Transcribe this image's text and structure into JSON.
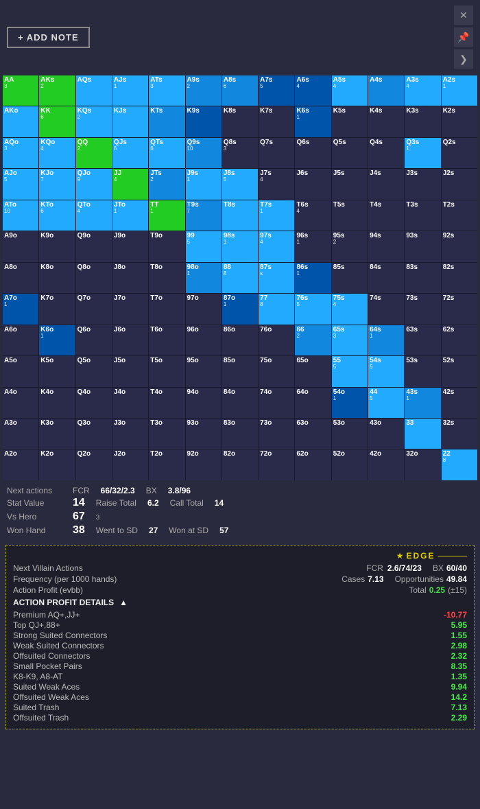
{
  "header": {
    "add_note_label": "+ ADD NOTE",
    "close_icon": "✕",
    "pin_icon": "📌",
    "arrow_icon": "❯"
  },
  "matrix": {
    "cells": [
      {
        "label": "AA",
        "count": "3",
        "color": "c-green"
      },
      {
        "label": "AKs",
        "count": "2",
        "color": "c-green"
      },
      {
        "label": "AQs",
        "count": "",
        "color": "c-blue-bright"
      },
      {
        "label": "AJs",
        "count": "1",
        "color": "c-blue-bright"
      },
      {
        "label": "ATs",
        "count": "3",
        "color": "c-blue-bright"
      },
      {
        "label": "A9s",
        "count": "2",
        "color": "c-blue-med"
      },
      {
        "label": "A8s",
        "count": "6",
        "color": "c-blue-med"
      },
      {
        "label": "A7s",
        "count": "5",
        "color": "c-blue-dark"
      },
      {
        "label": "A6s",
        "count": "4",
        "color": "c-blue-dark"
      },
      {
        "label": "A5s",
        "count": "4",
        "color": "c-blue-bright"
      },
      {
        "label": "A4s",
        "count": "",
        "color": "c-blue-med"
      },
      {
        "label": "A3s",
        "count": "4",
        "color": "c-blue-bright"
      },
      {
        "label": "A2s",
        "count": "1",
        "color": "c-blue-bright"
      },
      {
        "label": "AKo",
        "count": "",
        "color": "c-blue-bright"
      },
      {
        "label": "KK",
        "count": "6",
        "color": "c-green"
      },
      {
        "label": "KQs",
        "count": "2",
        "color": "c-blue-bright"
      },
      {
        "label": "KJs",
        "count": "",
        "color": "c-blue-bright"
      },
      {
        "label": "KTs",
        "count": "",
        "color": "c-blue-med"
      },
      {
        "label": "K9s",
        "count": "",
        "color": "c-blue-dark"
      },
      {
        "label": "K8s",
        "count": "",
        "color": "c-dark-cell"
      },
      {
        "label": "K7s",
        "count": "",
        "color": "c-dark-cell"
      },
      {
        "label": "K6s",
        "count": "1",
        "color": "c-blue-dark"
      },
      {
        "label": "K5s",
        "count": "",
        "color": "c-dark-cell"
      },
      {
        "label": "K4s",
        "count": "",
        "color": "c-dark-cell"
      },
      {
        "label": "K3s",
        "count": "",
        "color": "c-dark-cell"
      },
      {
        "label": "K2s",
        "count": "",
        "color": "c-dark-cell"
      },
      {
        "label": "AQo",
        "count": "3",
        "color": "c-blue-bright"
      },
      {
        "label": "KQo",
        "count": "4",
        "color": "c-blue-bright"
      },
      {
        "label": "QQ",
        "count": "2",
        "color": "c-green"
      },
      {
        "label": "QJs",
        "count": "6",
        "color": "c-blue-bright"
      },
      {
        "label": "QTs",
        "count": "6",
        "color": "c-blue-bright"
      },
      {
        "label": "Q9s",
        "count": "10",
        "color": "c-blue-med"
      },
      {
        "label": "Q8s",
        "count": "3",
        "color": "c-dark-cell"
      },
      {
        "label": "Q7s",
        "count": "",
        "color": "c-dark-cell"
      },
      {
        "label": "Q6s",
        "count": "",
        "color": "c-dark-cell"
      },
      {
        "label": "Q5s",
        "count": "",
        "color": "c-dark-cell"
      },
      {
        "label": "Q4s",
        "count": "",
        "color": "c-dark-cell"
      },
      {
        "label": "Q3s",
        "count": "1",
        "color": "c-blue-bright"
      },
      {
        "label": "Q2s",
        "count": "",
        "color": "c-dark-cell"
      },
      {
        "label": "AJo",
        "count": "5",
        "color": "c-blue-bright"
      },
      {
        "label": "KJo",
        "count": "7",
        "color": "c-blue-bright"
      },
      {
        "label": "QJo",
        "count": "9",
        "color": "c-blue-bright"
      },
      {
        "label": "JJ",
        "count": "4",
        "color": "c-green"
      },
      {
        "label": "JTs",
        "count": "2",
        "color": "c-blue-med"
      },
      {
        "label": "J9s",
        "count": "1",
        "color": "c-blue-bright"
      },
      {
        "label": "J8s",
        "count": "5",
        "color": "c-blue-bright"
      },
      {
        "label": "J7s",
        "count": "4",
        "color": "c-dark-cell"
      },
      {
        "label": "J6s",
        "count": "",
        "color": "c-dark-cell"
      },
      {
        "label": "J5s",
        "count": "",
        "color": "c-dark-cell"
      },
      {
        "label": "J4s",
        "count": "",
        "color": "c-dark-cell"
      },
      {
        "label": "J3s",
        "count": "",
        "color": "c-dark-cell"
      },
      {
        "label": "J2s",
        "count": "",
        "color": "c-dark-cell"
      },
      {
        "label": "ATo",
        "count": "10",
        "color": "c-blue-bright"
      },
      {
        "label": "KTo",
        "count": "6",
        "color": "c-blue-bright"
      },
      {
        "label": "QTo",
        "count": "4",
        "color": "c-blue-bright"
      },
      {
        "label": "JTo",
        "count": "1",
        "color": "c-blue-bright"
      },
      {
        "label": "TT",
        "count": "1",
        "color": "c-green"
      },
      {
        "label": "T9s",
        "count": "7",
        "color": "c-blue-med"
      },
      {
        "label": "T8s",
        "count": "",
        "color": "c-blue-bright"
      },
      {
        "label": "T7s",
        "count": "1",
        "color": "c-blue-bright"
      },
      {
        "label": "T6s",
        "count": "4",
        "color": "c-dark-cell"
      },
      {
        "label": "T5s",
        "count": "",
        "color": "c-dark-cell"
      },
      {
        "label": "T4s",
        "count": "",
        "color": "c-dark-cell"
      },
      {
        "label": "T3s",
        "count": "",
        "color": "c-dark-cell"
      },
      {
        "label": "T2s",
        "count": "",
        "color": "c-dark-cell"
      },
      {
        "label": "A9o",
        "count": "",
        "color": "c-dark-cell"
      },
      {
        "label": "K9o",
        "count": "",
        "color": "c-dark-cell"
      },
      {
        "label": "Q9o",
        "count": "",
        "color": "c-dark-cell"
      },
      {
        "label": "J9o",
        "count": "",
        "color": "c-dark-cell"
      },
      {
        "label": "T9o",
        "count": "",
        "color": "c-dark-cell"
      },
      {
        "label": "99",
        "count": "5",
        "color": "c-blue-bright"
      },
      {
        "label": "98s",
        "count": "1",
        "color": "c-blue-bright"
      },
      {
        "label": "97s",
        "count": "4",
        "color": "c-blue-bright"
      },
      {
        "label": "96s",
        "count": "1",
        "color": "c-dark-cell"
      },
      {
        "label": "95s",
        "count": "2",
        "color": "c-dark-cell"
      },
      {
        "label": "94s",
        "count": "",
        "color": "c-dark-cell"
      },
      {
        "label": "93s",
        "count": "",
        "color": "c-dark-cell"
      },
      {
        "label": "92s",
        "count": "",
        "color": "c-dark-cell"
      },
      {
        "label": "A8o",
        "count": "",
        "color": "c-dark-cell"
      },
      {
        "label": "K8o",
        "count": "",
        "color": "c-dark-cell"
      },
      {
        "label": "Q8o",
        "count": "",
        "color": "c-dark-cell"
      },
      {
        "label": "J8o",
        "count": "",
        "color": "c-dark-cell"
      },
      {
        "label": "T8o",
        "count": "",
        "color": "c-dark-cell"
      },
      {
        "label": "98o",
        "count": "1",
        "color": "c-blue-med"
      },
      {
        "label": "88",
        "count": "8",
        "color": "c-blue-bright"
      },
      {
        "label": "87s",
        "count": "s",
        "color": "c-blue-bright"
      },
      {
        "label": "86s",
        "count": "1",
        "color": "c-blue-dark"
      },
      {
        "label": "85s",
        "count": "",
        "color": "c-dark-cell"
      },
      {
        "label": "84s",
        "count": "",
        "color": "c-dark-cell"
      },
      {
        "label": "83s",
        "count": "",
        "color": "c-dark-cell"
      },
      {
        "label": "82s",
        "count": "",
        "color": "c-dark-cell"
      },
      {
        "label": "A7o",
        "count": "1",
        "color": "c-blue-dark"
      },
      {
        "label": "K7o",
        "count": "",
        "color": "c-dark-cell"
      },
      {
        "label": "Q7o",
        "count": "",
        "color": "c-dark-cell"
      },
      {
        "label": "J7o",
        "count": "",
        "color": "c-dark-cell"
      },
      {
        "label": "T7o",
        "count": "",
        "color": "c-dark-cell"
      },
      {
        "label": "97o",
        "count": "",
        "color": "c-dark-cell"
      },
      {
        "label": "87o",
        "count": "1",
        "color": "c-blue-dark"
      },
      {
        "label": "77",
        "count": "8",
        "color": "c-blue-bright"
      },
      {
        "label": "76s",
        "count": "5",
        "color": "c-blue-bright"
      },
      {
        "label": "75s",
        "count": "4",
        "color": "c-blue-bright"
      },
      {
        "label": "74s",
        "count": "",
        "color": "c-dark-cell"
      },
      {
        "label": "73s",
        "count": "",
        "color": "c-dark-cell"
      },
      {
        "label": "72s",
        "count": "",
        "color": "c-dark-cell"
      },
      {
        "label": "A6o",
        "count": "",
        "color": "c-dark-cell"
      },
      {
        "label": "K6o",
        "count": "1",
        "color": "c-blue-dark"
      },
      {
        "label": "Q6o",
        "count": "",
        "color": "c-dark-cell"
      },
      {
        "label": "J6o",
        "count": "",
        "color": "c-dark-cell"
      },
      {
        "label": "T6o",
        "count": "",
        "color": "c-dark-cell"
      },
      {
        "label": "96o",
        "count": "",
        "color": "c-dark-cell"
      },
      {
        "label": "86o",
        "count": "",
        "color": "c-dark-cell"
      },
      {
        "label": "76o",
        "count": "",
        "color": "c-dark-cell"
      },
      {
        "label": "66",
        "count": "2",
        "color": "c-blue-med"
      },
      {
        "label": "65s",
        "count": "3",
        "color": "c-blue-bright"
      },
      {
        "label": "64s",
        "count": "1",
        "color": "c-blue-med"
      },
      {
        "label": "63s",
        "count": "",
        "color": "c-dark-cell"
      },
      {
        "label": "62s",
        "count": "",
        "color": "c-dark-cell"
      },
      {
        "label": "A5o",
        "count": "",
        "color": "c-dark-cell"
      },
      {
        "label": "K5o",
        "count": "",
        "color": "c-dark-cell"
      },
      {
        "label": "Q5o",
        "count": "",
        "color": "c-dark-cell"
      },
      {
        "label": "J5o",
        "count": "",
        "color": "c-dark-cell"
      },
      {
        "label": "T5o",
        "count": "",
        "color": "c-dark-cell"
      },
      {
        "label": "95o",
        "count": "",
        "color": "c-dark-cell"
      },
      {
        "label": "85o",
        "count": "",
        "color": "c-dark-cell"
      },
      {
        "label": "75o",
        "count": "",
        "color": "c-dark-cell"
      },
      {
        "label": "65o",
        "count": "",
        "color": "c-dark-cell"
      },
      {
        "label": "55",
        "count": "5",
        "color": "c-blue-bright"
      },
      {
        "label": "54s",
        "count": "5",
        "color": "c-blue-bright"
      },
      {
        "label": "53s",
        "count": "",
        "color": "c-dark-cell"
      },
      {
        "label": "52s",
        "count": "",
        "color": "c-dark-cell"
      },
      {
        "label": "A4o",
        "count": "",
        "color": "c-dark-cell"
      },
      {
        "label": "K4o",
        "count": "",
        "color": "c-dark-cell"
      },
      {
        "label": "Q4o",
        "count": "",
        "color": "c-dark-cell"
      },
      {
        "label": "J4o",
        "count": "",
        "color": "c-dark-cell"
      },
      {
        "label": "T4o",
        "count": "",
        "color": "c-dark-cell"
      },
      {
        "label": "94o",
        "count": "",
        "color": "c-dark-cell"
      },
      {
        "label": "84o",
        "count": "",
        "color": "c-dark-cell"
      },
      {
        "label": "74o",
        "count": "",
        "color": "c-dark-cell"
      },
      {
        "label": "64o",
        "count": "",
        "color": "c-dark-cell"
      },
      {
        "label": "54o",
        "count": "1",
        "color": "c-blue-dark"
      },
      {
        "label": "44",
        "count": "5",
        "color": "c-blue-bright"
      },
      {
        "label": "43s",
        "count": "1",
        "color": "c-blue-med"
      },
      {
        "label": "42s",
        "count": "",
        "color": "c-dark-cell"
      },
      {
        "label": "A3o",
        "count": "",
        "color": "c-dark-cell"
      },
      {
        "label": "K3o",
        "count": "",
        "color": "c-dark-cell"
      },
      {
        "label": "Q3o",
        "count": "",
        "color": "c-dark-cell"
      },
      {
        "label": "J3o",
        "count": "",
        "color": "c-dark-cell"
      },
      {
        "label": "T3o",
        "count": "",
        "color": "c-dark-cell"
      },
      {
        "label": "93o",
        "count": "",
        "color": "c-dark-cell"
      },
      {
        "label": "83o",
        "count": "",
        "color": "c-dark-cell"
      },
      {
        "label": "73o",
        "count": "",
        "color": "c-dark-cell"
      },
      {
        "label": "63o",
        "count": "",
        "color": "c-dark-cell"
      },
      {
        "label": "53o",
        "count": "",
        "color": "c-dark-cell"
      },
      {
        "label": "43o",
        "count": "",
        "color": "c-dark-cell"
      },
      {
        "label": "33",
        "count": "",
        "color": "c-blue-bright"
      },
      {
        "label": "32s",
        "count": "",
        "color": "c-dark-cell"
      },
      {
        "label": "A2o",
        "count": "",
        "color": "c-dark-cell"
      },
      {
        "label": "K2o",
        "count": "",
        "color": "c-dark-cell"
      },
      {
        "label": "Q2o",
        "count": "",
        "color": "c-dark-cell"
      },
      {
        "label": "J2o",
        "count": "",
        "color": "c-dark-cell"
      },
      {
        "label": "T2o",
        "count": "",
        "color": "c-dark-cell"
      },
      {
        "label": "92o",
        "count": "",
        "color": "c-dark-cell"
      },
      {
        "label": "82o",
        "count": "",
        "color": "c-dark-cell"
      },
      {
        "label": "72o",
        "count": "",
        "color": "c-dark-cell"
      },
      {
        "label": "62o",
        "count": "",
        "color": "c-dark-cell"
      },
      {
        "label": "52o",
        "count": "",
        "color": "c-dark-cell"
      },
      {
        "label": "42o",
        "count": "",
        "color": "c-dark-cell"
      },
      {
        "label": "32o",
        "count": "",
        "color": "c-dark-cell"
      },
      {
        "label": "22",
        "count": "8",
        "color": "c-blue-bright"
      }
    ]
  },
  "stats": {
    "next_actions_label": "Next actions",
    "fcr_label": "FCR",
    "fcr_value": "66/32/2.3",
    "bx_label": "BX",
    "bx_value": "3.8/96",
    "stat_value_label": "Stat Value",
    "stat_value": "14",
    "raise_total_label": "Raise Total",
    "raise_total_value": "6.2",
    "call_total_label": "Call Total",
    "call_total_value": "14",
    "vs_hero_label": "Vs Hero",
    "vs_hero_value": "67",
    "vs_hero_sub": "3",
    "won_hand_label": "Won Hand",
    "won_hand_value": "38",
    "went_to_sd_label": "Went to SD",
    "went_to_sd_value": "27",
    "won_at_sd_label": "Won at SD",
    "won_at_sd_value": "57"
  },
  "edge_box": {
    "title": "EDGE",
    "next_villain_label": "Next Villain Actions",
    "fcr_label": "FCR",
    "fcr_value": "2.6/74/23",
    "bx_label": "BX",
    "bx_value": "60/40",
    "frequency_label": "Frequency (per 1000 hands)",
    "cases_label": "Cases",
    "cases_value": "7.13",
    "opportunities_label": "Opportunities",
    "opportunities_value": "49.84",
    "action_profit_label": "Action Profit (evbb)",
    "total_label": "Total",
    "total_value": "0.25",
    "total_sub": "(±15)",
    "action_profit_details_label": "ACTION PROFIT DETAILS",
    "profit_items": [
      {
        "label": "Premium AQ+,JJ+",
        "value": "-10.77",
        "positive": false
      },
      {
        "label": "Top QJ+,88+",
        "value": "5.95",
        "positive": true
      },
      {
        "label": "Strong Suited Connectors",
        "value": "1.55",
        "positive": true
      },
      {
        "label": "Weak Suited Connectors",
        "value": "2.98",
        "positive": true
      },
      {
        "label": "Offsuited Connectors",
        "value": "2.32",
        "positive": true
      },
      {
        "label": "Small Pocket Pairs",
        "value": "8.35",
        "positive": true
      },
      {
        "label": "K8-K9, A8-AT",
        "value": "1.35",
        "positive": true
      },
      {
        "label": "Suited Weak Aces",
        "value": "9.94",
        "positive": true
      },
      {
        "label": "Offsuited Weak Aces",
        "value": "14.2",
        "positive": true
      },
      {
        "label": "Suited Trash",
        "value": "7.13",
        "positive": true
      },
      {
        "label": "Offsuited Trash",
        "value": "2.29",
        "positive": true
      }
    ]
  }
}
